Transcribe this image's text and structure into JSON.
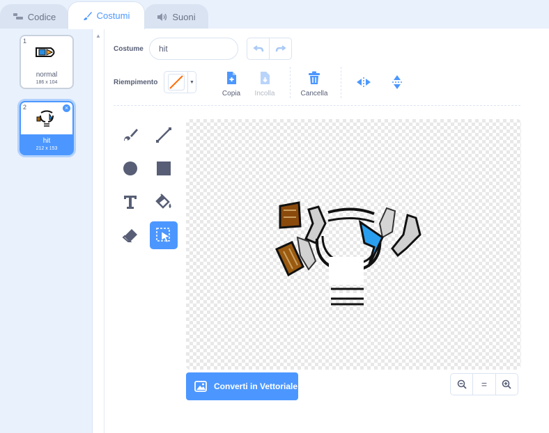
{
  "tabs": [
    {
      "label": "Codice",
      "icon": "code-icon"
    },
    {
      "label": "Costumi",
      "icon": "brush-icon"
    },
    {
      "label": "Suoni",
      "icon": "speaker-icon"
    }
  ],
  "costumes": [
    {
      "number": "1",
      "name": "normal",
      "size": "186 x 104"
    },
    {
      "number": "2",
      "name": "hit",
      "size": "212 x 153"
    }
  ],
  "toolbar": {
    "costume_label": "Costume",
    "costume_name": "hit",
    "fill_label": "Riempimento",
    "fill_color": "#ff6a00",
    "copy_label": "Copia",
    "paste_label": "Incolla",
    "delete_label": "Cancella"
  },
  "convert_label": "Converti in Vettoriale",
  "zoom": {
    "out": "−",
    "reset": "=",
    "in": "+"
  },
  "colors": {
    "accent": "#4c97ff",
    "text": "#575e75",
    "disabled": "#b4bac6"
  }
}
